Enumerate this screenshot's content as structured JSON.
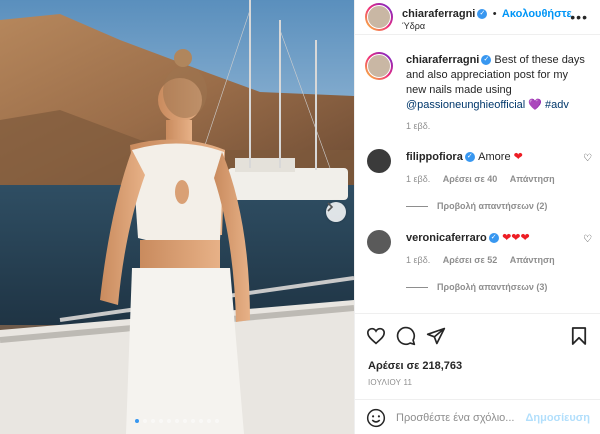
{
  "post": {
    "username": "chiaraferragni",
    "follow_label": "Ακολουθήστε",
    "location": "Ύδρα",
    "more_label": "•••"
  },
  "caption": {
    "username": "chiaraferragni",
    "text": " Best of these days and also appreciation post for my new nails made using ",
    "mention": "@passioneunghieofficial",
    "heart": "💜",
    "hashtag": "#adv",
    "time": "1 εβδ."
  },
  "comments": [
    {
      "username": "filippofiora",
      "text": "Amore ",
      "hearts": "❤",
      "time": "1 εβδ.",
      "likes": "Αρέσει σε 40",
      "reply": "Απάντηση",
      "view_replies": "Προβολή απαντήσεων (2)"
    },
    {
      "username": "veronicaferraro",
      "text": "",
      "hearts": "❤❤❤",
      "time": "1 εβδ.",
      "likes": "Αρέσει σε 52",
      "reply": "Απάντηση",
      "view_replies": "Προβολή απαντήσεων (3)"
    }
  ],
  "actions": {
    "likes": "Αρέσει σε 218,763",
    "date": "ΙΟΥΛΙΟΥ 11"
  },
  "compose": {
    "placeholder": "Προσθέστε ένα σχόλιο...",
    "post_label": "Δημοσίευση"
  },
  "carousel": {
    "total": 11,
    "active": 0
  },
  "colors": {
    "accent": "#0095f6",
    "verified": "#3897f0",
    "heart": "#ed1d24",
    "muted": "#8e8e8e"
  }
}
